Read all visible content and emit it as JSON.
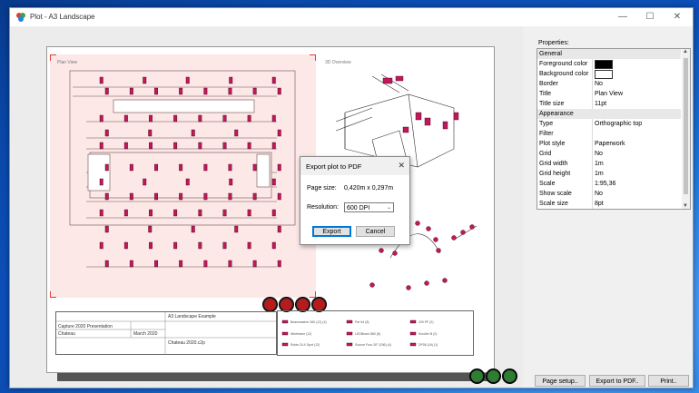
{
  "window": {
    "title": "Plot - A3 Landscape"
  },
  "paper": {
    "plan_view_label": "Plan View",
    "overview_label": "3D Overview",
    "title_block": {
      "project": "Capture 2020 Presentation",
      "location": "Chateau",
      "date": "March 2020",
      "layout": "A3 Landscape Example",
      "file": "Chateau 2020.c2p"
    },
    "legend": [
      "Beamwasher 360 (12) (4)",
      "Par 64 (8)",
      "229 PF (2)",
      "Wireframe (12)",
      "LEDBeam 880 (8)",
      "Scroller B (2)",
      "Robin DLX Spot (12)",
      "Source Four 26° (036) (4)",
      "DP06 (16) (1)"
    ]
  },
  "dialog": {
    "title": "Export plot to PDF",
    "page_size_label": "Page size:",
    "page_size_value": "0,420m x 0,297m",
    "resolution_label": "Resolution:",
    "resolution_value": "600 DPI",
    "export_label": "Export",
    "cancel_label": "Cancel"
  },
  "properties": {
    "label": "Properties:",
    "rows": [
      {
        "type": "category",
        "name": "General"
      },
      {
        "name": "Foreground color",
        "swatch": "#000000"
      },
      {
        "name": "Background color",
        "swatch": "#ffffff"
      },
      {
        "name": "Border",
        "value": "No"
      },
      {
        "name": "Title",
        "value": "Plan View"
      },
      {
        "name": "Title size",
        "value": "11pt"
      },
      {
        "type": "category",
        "name": "Appearance"
      },
      {
        "name": "Type",
        "value": "Orthographic top"
      },
      {
        "name": "Filter",
        "value": ""
      },
      {
        "name": "Plot style",
        "value": "Paperwork"
      },
      {
        "name": "Grid",
        "value": "No"
      },
      {
        "name": "Grid width",
        "value": "1m"
      },
      {
        "name": "Grid height",
        "value": "1m"
      },
      {
        "name": "Scale",
        "value": "1:95,36"
      },
      {
        "name": "Show scale",
        "value": "No"
      },
      {
        "name": "Scale size",
        "value": "8pt"
      }
    ]
  },
  "buttons": {
    "page_setup": "Page setup..",
    "export_pdf": "Export to PDF..",
    "print": "Print.."
  },
  "colors": {
    "accent": "#0078d7",
    "plan_bg": "#fde8e8",
    "fixture": "#c2185b"
  }
}
